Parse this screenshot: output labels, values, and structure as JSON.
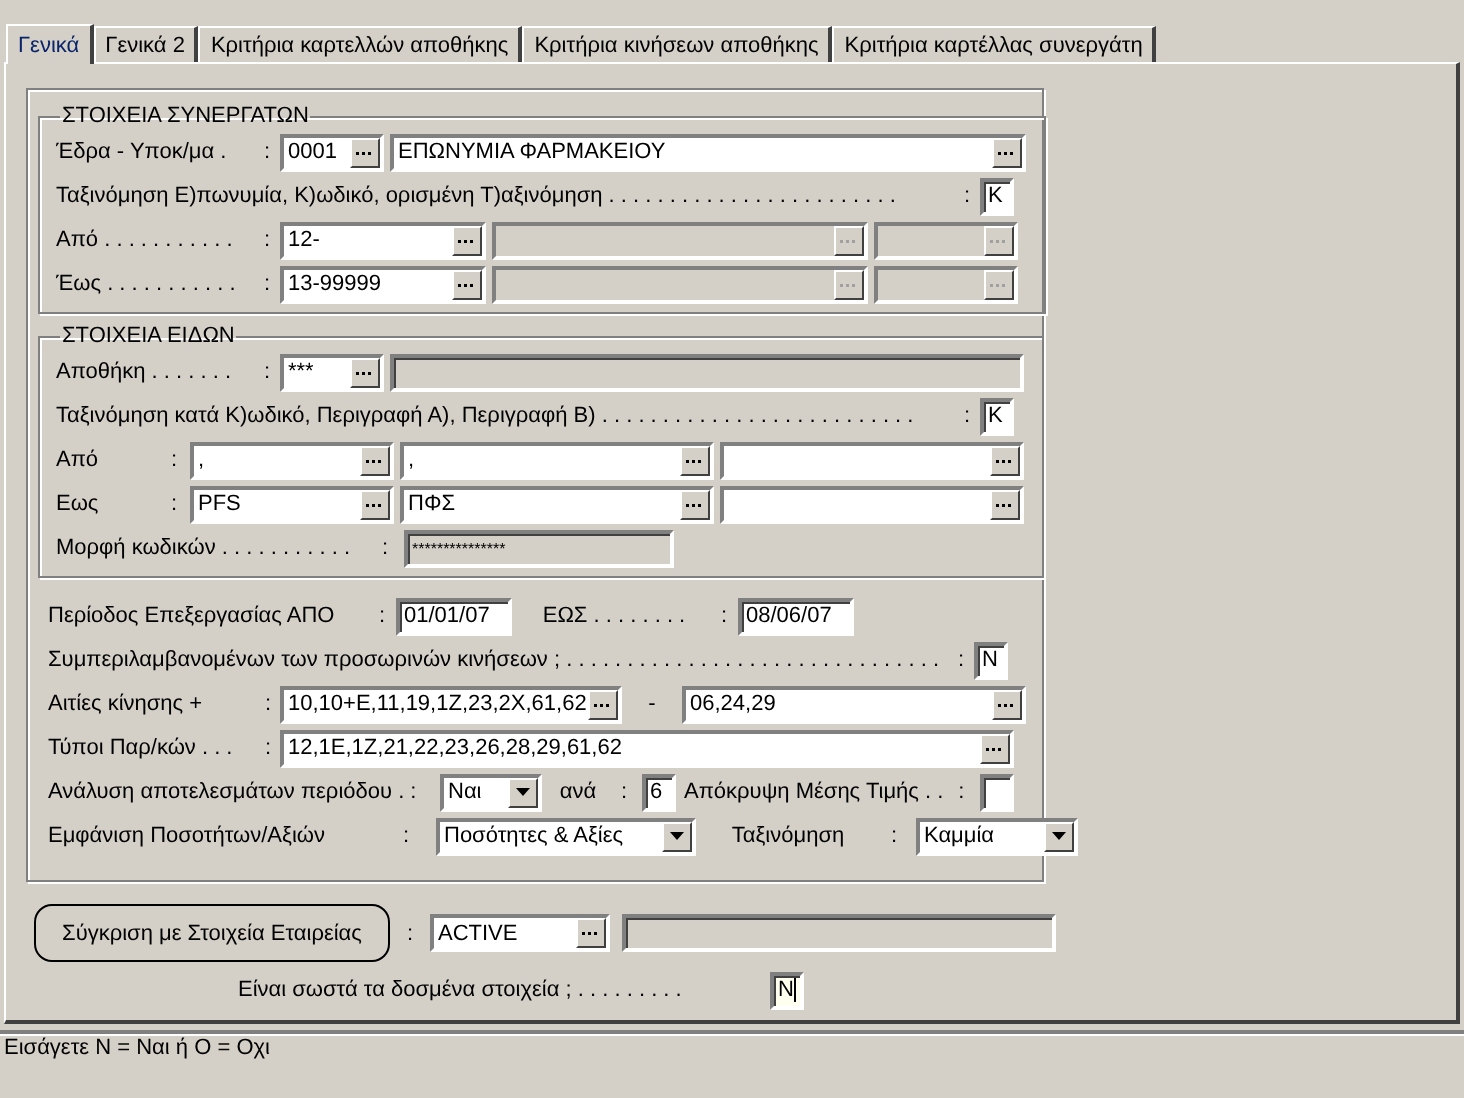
{
  "tabs": [
    {
      "label": "Γενικά",
      "selected": true
    },
    {
      "label": "Γενικά 2",
      "selected": false
    },
    {
      "label": "Κριτήρια καρτελλών αποθήκης",
      "selected": false
    },
    {
      "label": "Κριτήρια κινήσεων αποθήκης",
      "selected": false
    },
    {
      "label": "Κριτήρια καρτέλλας συνεργάτη",
      "selected": false
    }
  ],
  "partners": {
    "title": "ΣΤΟΙΧΕΙΑ ΣΥΝΕΡΓΑΤΩΝ",
    "rows": [
      {
        "label": "Έδρα - Υποκ/μα .",
        "items": [
          {
            "kind": "label",
            "text": ":"
          },
          {
            "kind": "lookup",
            "value": "0001",
            "disabled": false
          },
          {
            "kind": "lookup",
            "value": "ΕΠΩΝΥΜΙΑ ΦΑΡΜΑΚΕΙΟΥ",
            "disabled": false
          }
        ]
      },
      {
        "label": "Ταξινόμηση Ε)πωνυμία, Κ)ωδικό, ορισμένη Τ)αξινόμηση . . . . . . . . . . . . . . . . . . . . . . . .",
        "items": [
          {
            "kind": "label",
            "text": ":"
          },
          {
            "kind": "flag",
            "value": "K",
            "focused": false
          }
        ]
      },
      {
        "label": "Από . . . . . . . . . . .",
        "items": [
          {
            "kind": "label",
            "text": ":"
          },
          {
            "kind": "lookup",
            "value": "12-",
            "disabled": false
          },
          {
            "kind": "lookup",
            "disabled": true
          },
          {
            "kind": "lookup",
            "disabled": true
          }
        ]
      },
      {
        "label": "Έως . . . . . . . . . . .",
        "items": [
          {
            "kind": "label",
            "text": ":"
          },
          {
            "kind": "lookup",
            "value": "13-99999",
            "disabled": false
          },
          {
            "kind": "lookup",
            "disabled": true
          },
          {
            "kind": "lookup",
            "disabled": true
          }
        ]
      }
    ]
  },
  "items": {
    "title": "ΣΤΟΙΧΕΙΑ ΕΙΔΩΝ",
    "rows": [
      {
        "label": "Αποθήκη . . . . . . .",
        "items": [
          {
            "kind": "label",
            "text": ":"
          },
          {
            "kind": "lookup",
            "value": "***",
            "disabled": false
          },
          {
            "kind": "input",
            "disabled": true
          }
        ]
      },
      {
        "label": "Ταξινόμηση κατά Κ)ωδικό,  Περιγραφή Α),  Περιγραφή Β) . . . . . . . . . . . . . . . . . . . . . . . . . .",
        "items": [
          {
            "kind": "label",
            "text": ":"
          },
          {
            "kind": "flag",
            "value": "K",
            "focused": false
          }
        ]
      },
      {
        "label": "Από",
        "items": [
          {
            "kind": "label",
            "text": ":"
          },
          {
            "kind": "lookup",
            "value": ",",
            "disabled": false
          },
          {
            "kind": "lookup",
            "value": ",",
            "disabled": false
          },
          {
            "kind": "lookup",
            "disabled": false
          }
        ]
      },
      {
        "label": "Εως",
        "items": [
          {
            "kind": "label",
            "text": ":"
          },
          {
            "kind": "lookup",
            "value": "PFS",
            "disabled": false
          },
          {
            "kind": "lookup",
            "value": "ΠΦΣ",
            "disabled": false
          },
          {
            "kind": "lookup",
            "disabled": false
          }
        ]
      },
      {
        "label": "Μορφή κωδικών . . . . . . . . . . .",
        "items": [
          {
            "kind": "label",
            "text": ":"
          },
          {
            "kind": "input",
            "value": "***************",
            "disabled": true
          }
        ]
      }
    ]
  },
  "period": {
    "rows": [
      {
        "label": "Περίοδος Επεξεργασίας  ΑΠΟ",
        "items": [
          {
            "kind": "label",
            "text": ":"
          },
          {
            "kind": "input",
            "value": "01/01/07",
            "disabled": false
          },
          {
            "kind": "label",
            "text": "ΕΩΣ . . . . . . . ."
          },
          {
            "kind": "label",
            "text": ":"
          },
          {
            "kind": "input",
            "value": "08/06/07",
            "disabled": false
          }
        ]
      },
      {
        "label": "Συμπεριλαμβανομένων των προσωρινών κινήσεων ; . . . . . . . . . . . . . . . . . . . . . . . . . . . . . . .",
        "items": [
          {
            "kind": "label",
            "text": ":"
          },
          {
            "kind": "flag",
            "value": "N",
            "focused": false
          }
        ]
      },
      {
        "label": "Αιτίες κίνησης +",
        "items": [
          {
            "kind": "label",
            "text": ":"
          },
          {
            "kind": "lookup",
            "value": "10,10+E,11,19,1Z,23,2X,61,62",
            "disabled": false
          },
          {
            "kind": "label",
            "text": "-"
          },
          {
            "kind": "lookup",
            "value": "06,24,29",
            "disabled": false
          }
        ]
      },
      {
        "label": "Τύποι Παρ/κών . . .",
        "items": [
          {
            "kind": "label",
            "text": ":"
          },
          {
            "kind": "lookup",
            "value": "12,1E,1Z,21,22,23,26,28,29,61,62",
            "disabled": false
          }
        ]
      },
      {
        "label": "Ανάλυση αποτελεσμάτων περιόδου . :",
        "items": [
          {
            "kind": "select",
            "value": "Ναι"
          },
          {
            "kind": "label",
            "text": "ανά"
          },
          {
            "kind": "label",
            "text": ":"
          },
          {
            "kind": "input",
            "value": "6",
            "disabled": false
          },
          {
            "kind": "label",
            "text": "Απόκρυψη Μέσης Τιμής . ."
          },
          {
            "kind": "label",
            "text": ":"
          },
          {
            "kind": "flag",
            "focused": false
          }
        ]
      },
      {
        "label": "Εμφάνιση Ποσοτήτων/Αξιών",
        "items": [
          {
            "kind": "label",
            "text": ":"
          },
          {
            "kind": "select",
            "value": "Ποσότητες & Αξίες"
          },
          {
            "kind": "label",
            "text": "Ταξινόμηση"
          },
          {
            "kind": "label",
            "text": ":"
          },
          {
            "kind": "select",
            "value": "Καμμία"
          }
        ]
      }
    ]
  },
  "compare": {
    "button": "Σύγκριση με Στοιχεία Εταιρείας",
    "items": [
      {
        "kind": "label",
        "text": ":"
      },
      {
        "kind": "lookup",
        "value": "ACTIVE",
        "disabled": false
      },
      {
        "kind": "input",
        "disabled": true
      }
    ]
  },
  "confirm": {
    "label": "Είναι σωστά τα δοσμένα στοιχεία ; . . . . . . . . .",
    "items": [
      {
        "kind": "flag",
        "value": "N",
        "focused": true
      }
    ]
  },
  "status_bar": "Εισάγετε Ν = Ναι  ή  Ο = Οχι"
}
